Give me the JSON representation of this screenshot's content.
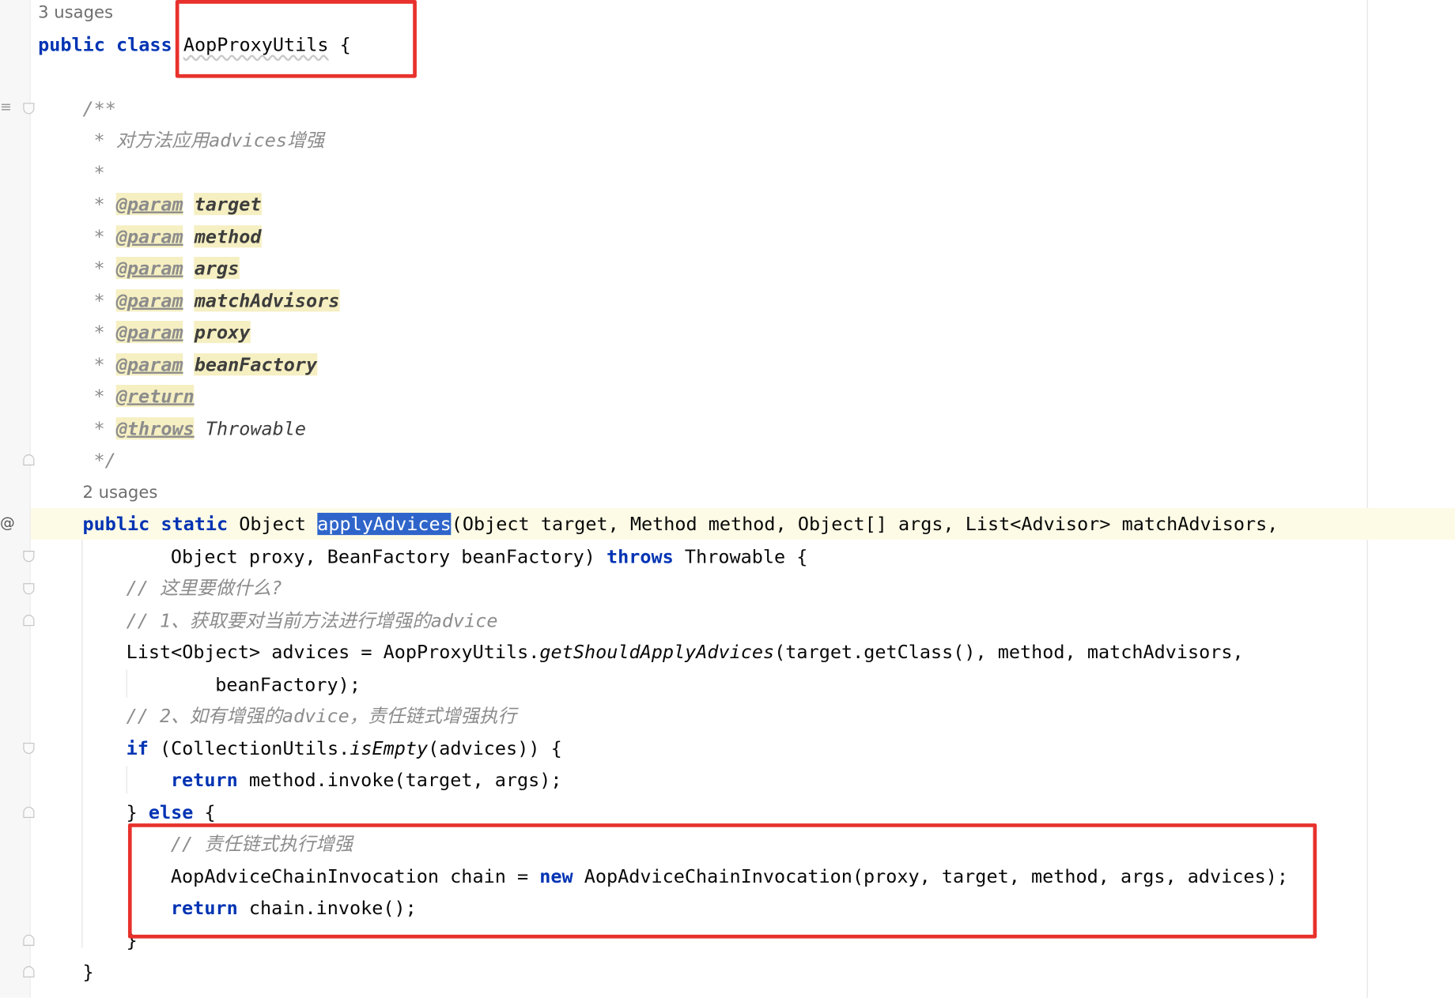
{
  "class_usages": "3 usages",
  "class_decl": {
    "kw": "public class",
    "name": "AopProxyUtils",
    "brace": "{"
  },
  "javadoc": {
    "open": "/**",
    "summary": "* 对方法应用advices增强",
    "blank": "*",
    "star": "*",
    "params": [
      {
        "tag": "@param",
        "name": "target"
      },
      {
        "tag": "@param",
        "name": "method"
      },
      {
        "tag": "@param",
        "name": "args"
      },
      {
        "tag": "@param",
        "name": "matchAdvisors"
      },
      {
        "tag": "@param",
        "name": "proxy"
      },
      {
        "tag": "@param",
        "name": "beanFactory"
      }
    ],
    "return_tag": "@return",
    "throws_tag": "@throws",
    "throws_type": "Throwable",
    "close": "*/"
  },
  "method_usages": "2 usages",
  "method_decl": {
    "kw1": "public",
    "kw2": "static",
    "ret": "Object",
    "name": "applyAdvices",
    "params1": "(Object target, Method method, Object[] args, List<Advisor> matchAdvisors,",
    "params2": "Object proxy, BeanFactory beanFactory)",
    "throws_kw": "throws",
    "throws_rest": "Throwable {"
  },
  "body": {
    "c1": "// 这里要做什么?",
    "c2": "// 1、获取要对当前方法进行增强的advice",
    "l1a": "List<Object> advices = AopProxyUtils.",
    "l1m": "getShouldApplyAdvices",
    "l1b": "(target.getClass(), method, matchAdvisors,",
    "l2": "beanFactory);",
    "c3": "// 2、如有增强的advice，责任链式增强执行",
    "if_kw": "if",
    "if_a": "(CollectionUtils.",
    "if_m": "isEmpty",
    "if_b": "(advices)) {",
    "ret_kw": "return",
    "ret1_rest": "method.invoke(target, args);",
    "else_a": "}",
    "else_kw": "else",
    "else_b": "{",
    "c4": "// 责任链式执行增强",
    "chain_a": "AopAdviceChainInvocation chain = ",
    "new_kw": "new",
    "chain_b": "AopAdviceChainInvocation(proxy, target, method, args, advices);",
    "ret2_rest": "chain.invoke();",
    "inner_close": "}",
    "outer_close": "}"
  },
  "gutter": {
    "override_icon": "@",
    "doc_icon": "javadoc-icon"
  },
  "colors": {
    "keyword": "#0033b3",
    "comment": "#8c8c8c",
    "selection": "#2f65ca",
    "highlight_line": "#fdfbe6",
    "annotation_box": "#e8312c"
  }
}
